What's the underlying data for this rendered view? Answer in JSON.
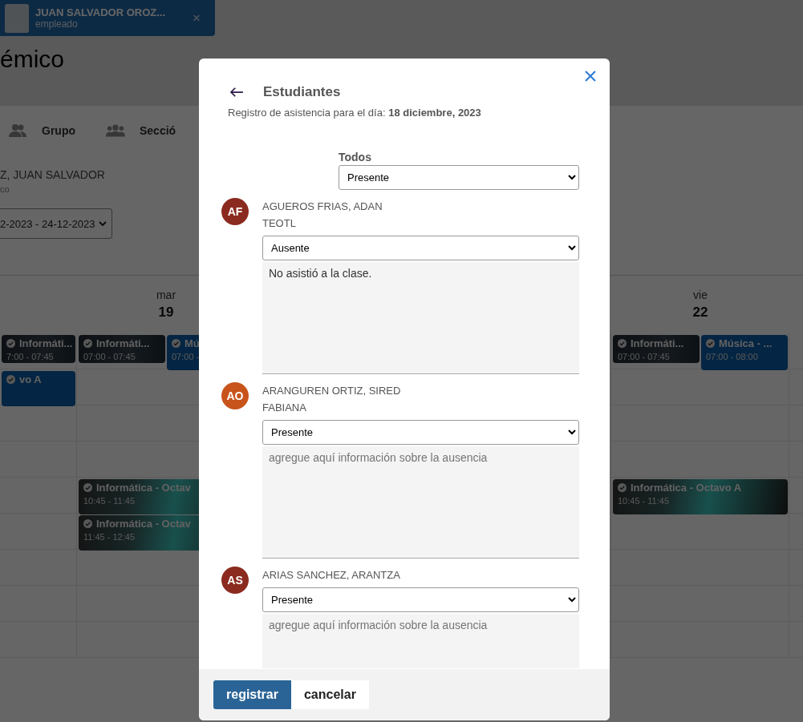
{
  "user_chip": {
    "name": "JUAN SALVADOR OROZ...",
    "role": "empleado",
    "close": "×"
  },
  "page_title": "émico",
  "tabs": [
    {
      "label": "Grupo",
      "kind": "pair"
    },
    {
      "label": "Secció",
      "kind": "trio"
    }
  ],
  "teacher": {
    "name": "Z, JUAN SALVADOR",
    "subtitle": "co"
  },
  "week_select": {
    "value": "2-2023 - 24-12-2023"
  },
  "calendar": {
    "days": [
      {
        "slots": [
          {
            "kind": "first",
            "events": [
              {
                "title": "Informáti...",
                "time": "7:00 - 07:45",
                "kind": "image"
              }
            ]
          },
          {
            "kind": "second",
            "events": [
              {
                "title": "vo A",
                "kind": "plain"
              }
            ]
          }
        ]
      },
      {
        "weekday": "mar",
        "day": "19",
        "slots": [
          {
            "kind": "first",
            "events": [
              {
                "title": "Informáti...",
                "time": "07:00 - 07:45",
                "kind": "image"
              },
              {
                "title": "Mú",
                "time": "07:00 -",
                "kind": "plain"
              }
            ]
          },
          {
            "kind": "fifth",
            "events": [
              {
                "title": "Informática - Octav",
                "time": "10:45 - 11:45",
                "kind": "mesh"
              }
            ]
          },
          {
            "kind": "sixth",
            "events": [
              {
                "title": "Informática - Octav",
                "time": "11:45 - 12:45",
                "kind": "mesh"
              }
            ]
          }
        ]
      },
      {
        "weekday": "vie",
        "day": "22",
        "slots": [
          {
            "kind": "first",
            "events": [
              {
                "title": "Informáti...",
                "time": "07:00 - 07:45",
                "kind": "image"
              },
              {
                "title": "Música - ...",
                "time": "07:00 - 08:00",
                "kind": "plain"
              }
            ]
          },
          {
            "kind": "fifth",
            "events": [
              {
                "title": "Informática - Octavo A",
                "time": "10:45 - 11:45",
                "kind": "mesh"
              }
            ]
          }
        ]
      }
    ]
  },
  "modal": {
    "title": "Estudiantes",
    "subtitle": "Registro de asistencia para el día: **18 diciembre, 2023**",
    "all_label": "Todos",
    "all_value": "Presente",
    "students": [
      {
        "initials": "AF",
        "color": "#8b2a1f",
        "name": "AGUEROS FRIAS, ADAN TEOTL",
        "status": "Ausente",
        "note": "No asistió a la clase."
      },
      {
        "initials": "AO",
        "color": "#c8541c",
        "name": "ARANGUREN ORTIZ, SIRED FABIANA",
        "status": "Presente",
        "placeholder": "agregue aquí información sobre la ausencia"
      },
      {
        "initials": "AS",
        "color": "#8b2a1f",
        "name": "ARIAS SANCHEZ, ARANTZA",
        "status": "Presente",
        "placeholder": "agregue aquí información sobre la ausencia"
      }
    ],
    "buttons": [
      {
        "label": "registrar",
        "kind": "primary"
      },
      {
        "label": "cancelar",
        "kind": "secondary"
      }
    ]
  }
}
